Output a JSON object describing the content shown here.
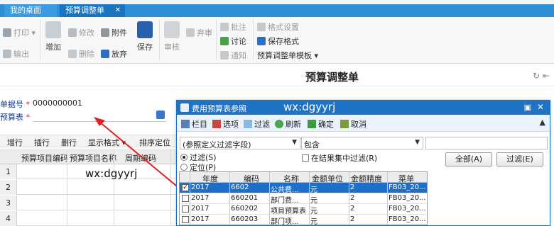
{
  "tabs": [
    {
      "label": "我的桌面",
      "active": false
    },
    {
      "label": "预算调整单",
      "active": true
    }
  ],
  "ribbon": {
    "print": "打印",
    "export": "输出",
    "add": "增加",
    "edit": "修改",
    "attach": "附件",
    "delete": "删除",
    "discard": "放弃",
    "save": "保存",
    "audit": "审核",
    "abandon": "弃审",
    "annotate": "批注",
    "discuss": "讨论",
    "notify": "通知",
    "format_settings": "格式设置",
    "save_format": "保存格式",
    "template": "预算调整单模板"
  },
  "page_title": "预算调整单",
  "form": {
    "doc_no_label": "单据号",
    "doc_no_value": "0000000001",
    "budget_table_label": "预算表"
  },
  "grid": {
    "toolbar": [
      "增行",
      "插行",
      "删行",
      "显示格式",
      "排序定位"
    ],
    "columns": [
      "预算项目编码",
      "预算项目名称",
      "周期编码"
    ],
    "rows": [
      "1",
      "2",
      "3",
      "4"
    ],
    "watermark": "wx:dgyyrj"
  },
  "dialog": {
    "title": "费用预算表参照",
    "watermark": "wx:dgyyrj",
    "toolbar": [
      "栏目",
      "选项",
      "过滤",
      "刷新",
      "确定",
      "取消"
    ],
    "filter_field": "(参照定义过滤字段)",
    "operator": "包含",
    "filter_value": "",
    "radio_filter": "过滤(S)",
    "radio_locate": "定位(P)",
    "in_result_filter": "在结果集中过滤(R)",
    "btn_all": "全部(A)",
    "btn_filter": "过滤(E)",
    "columns": [
      "年度",
      "编码",
      "名称",
      "金额单位",
      "金额精度",
      "菜单"
    ],
    "rows": [
      {
        "checked": true,
        "year": "2017",
        "code": "6602",
        "name": "公共费...",
        "unit": "元",
        "precision": "2",
        "menu": "FB03_20..."
      },
      {
        "checked": false,
        "year": "2017",
        "code": "660201",
        "name": "部门费...",
        "unit": "元",
        "precision": "2",
        "menu": "FB03_20..."
      },
      {
        "checked": false,
        "year": "2017",
        "code": "660202",
        "name": "项目预算表",
        "unit": "元",
        "precision": "2",
        "menu": "FB03_20..."
      },
      {
        "checked": false,
        "year": "2017",
        "code": "660203",
        "name": "部门项...",
        "unit": "元",
        "precision": "2",
        "menu": "FB03_20..."
      }
    ]
  },
  "colors": {
    "accent": "#1e73c4",
    "arrow": "#e02020",
    "selection": "#1e6fc7"
  }
}
